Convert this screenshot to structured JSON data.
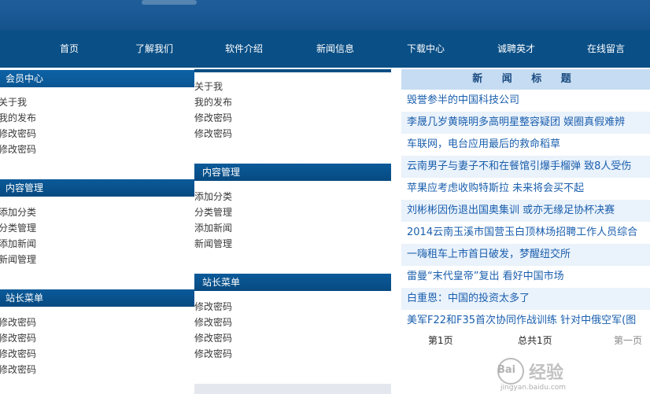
{
  "nav": {
    "items": [
      "首页",
      "了解我们",
      "软件介绍",
      "新闻信息",
      "下载中心",
      "诚聘英才",
      "在线留言"
    ]
  },
  "left_menu": {
    "member": {
      "title": "会员中心",
      "items": [
        "关于我",
        "我的发布",
        "修改密码",
        "修改密码"
      ]
    },
    "content": {
      "title": "内容管理",
      "items": [
        "添加分类",
        "分类管理",
        "添加新闻",
        "新闻管理"
      ]
    },
    "admin": {
      "title": "站长菜单",
      "items": [
        "修改密码",
        "修改密码",
        "修改密码",
        "修改密码"
      ]
    }
  },
  "mid_menu": {
    "member": {
      "items": [
        "关于我",
        "我的发布",
        "修改密码",
        "修改密码"
      ]
    },
    "content": {
      "title": "内容管理",
      "items": [
        "添加分类",
        "分类管理",
        "添加新闻",
        "新闻管理"
      ]
    },
    "admin": {
      "title": "站长菜单",
      "items": [
        "修改密码",
        "修改密码",
        "修改密码",
        "修改密码"
      ]
    }
  },
  "news": {
    "title": "新 闻 标 题",
    "items": [
      "毁誉参半的中国科技公司",
      "李晟几岁黄晓明多高明星整容疑团 娱圈真假难辨",
      "车联网，电台应用最后的救命稻草",
      "云南男子与妻子不和在餐馆引爆手榴弹 致8人受伤",
      "苹果应考虑收购特斯拉 未来将会买不起",
      "刘彬彬因伤退出国奥集训 或亦无缘足协杯决赛",
      "2014云南玉溪市国营玉白顶林场招聘工作人员综合",
      "一嗨租车上市首日破发，梦醒纽交所",
      "雷曼“末代皇帝”复出 看好中国市场",
      "白重恩：中国的投资太多了",
      "美军F22和F35首次协同作战训练 针对中俄空军(图"
    ]
  },
  "pager": {
    "current": "第1页",
    "total": "总共1页",
    "first": "第一页"
  },
  "watermark": {
    "brand": "Bai",
    "text": "经验",
    "url": "jingyan.baidu.com"
  },
  "colors": {
    "nav_bg": "#0a4f86",
    "banner": "#1a5a96",
    "link_blue": "#1a5fae",
    "news_header": "#c6dcf2"
  }
}
